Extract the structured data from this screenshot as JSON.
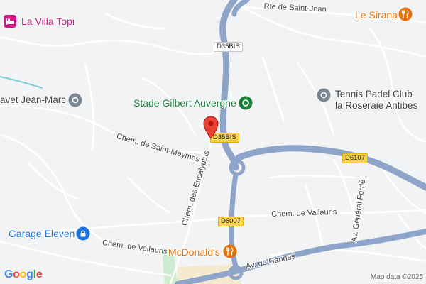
{
  "map": {
    "colors": {
      "background": "#f1f3f4",
      "major_road": "#8ea4c8",
      "minor_road": "#ffffff",
      "water": "#7dcfd6",
      "park": "#cdeccf",
      "pin": "#ea4335",
      "poi_green": "#188038",
      "poi_orange": "#e8710a",
      "poi_pink": "#d01884",
      "poi_blue": "#1a73e8",
      "poi_gray": "#5f6368"
    },
    "places": {
      "la_villa_topi": {
        "label": "La Villa Topi",
        "icon": "hotel-icon"
      },
      "le_sirana": {
        "label": "Le Sirana",
        "icon": "restaurant-icon"
      },
      "stade": {
        "label": "Stade Gilbert Auvergne",
        "icon": "stadium-icon"
      },
      "tennis_line1": "Tennis Padel Club",
      "tennis_line2": "la Roseraie Antibes",
      "tennis_icon": "place-icon",
      "vet": {
        "label": "avet Jean-Marc",
        "icon": "place-icon"
      },
      "garage": {
        "label": "Garage Eleven",
        "icon": "lock-icon"
      },
      "mcdonalds": {
        "label": "McDonald's",
        "icon": "restaurant-icon"
      }
    },
    "streets": {
      "rte_saint_jean": "Rte de Saint-Jean",
      "saint_maymes": "Chem. de Saint-Maymes",
      "eucalyptus": "Chem. des Eucalyptus",
      "vallauris_east": "Chem. de Vallauris",
      "vallauris_west": "Chem. de Vallauris",
      "general_ferrie": "Av. Général Ferrié",
      "av_cannes": "Av. de Cannes"
    },
    "shields": {
      "d35bis_top": "D35BIS",
      "d35bis_pin": "D35BIS",
      "d6107": "D6107",
      "d6007": "D6007"
    },
    "pin_icon": "map-pin-icon",
    "logo": {
      "letters": [
        "G",
        "o",
        "o",
        "g",
        "l",
        "e"
      ],
      "colors": [
        "#4285f4",
        "#ea4335",
        "#fbbc05",
        "#4285f4",
        "#34a853",
        "#ea4335"
      ]
    },
    "attribution": "Map data ©2025"
  }
}
